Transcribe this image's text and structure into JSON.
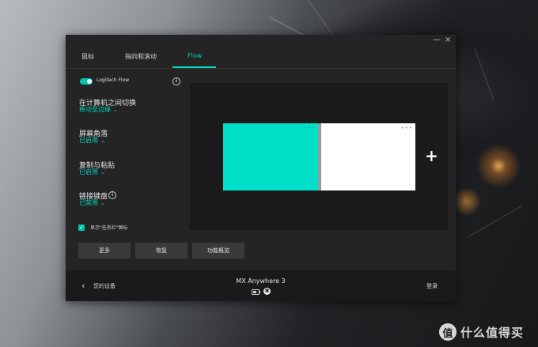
{
  "window": {
    "controls": {
      "minimize": "—",
      "close": "×"
    },
    "tabs": [
      {
        "label": "鼠标",
        "active": false
      },
      {
        "label": "指向和滚动",
        "active": false
      },
      {
        "label": "Flow",
        "active": true
      }
    ]
  },
  "flow": {
    "toggle_label": "Logitech Flow",
    "toggle_on": true,
    "info_icon": "info-icon",
    "settings": [
      {
        "title": "在计算机之间切换",
        "value": "移动至边缘"
      },
      {
        "title": "屏幕角落",
        "value": "已启用"
      },
      {
        "title": "复制与粘贴",
        "value": "已启用"
      },
      {
        "title": "链接键盘",
        "value": "已禁用"
      }
    ],
    "taskbar_checkbox_label": "显示\"任务栏\"图标",
    "taskbar_checked": true,
    "buttons": {
      "more": "更多",
      "restore": "恢复",
      "overview": "功能概览"
    },
    "preview": {
      "screen_a_color": "#00e0c8",
      "screen_b_color": "#ffffff",
      "menu_dots": "•••",
      "add": "+"
    }
  },
  "bottom": {
    "back_label": "您的设备",
    "device_name": "MX Anywhere 3",
    "login_label": "登录",
    "bluetooth_glyph": "✱"
  },
  "watermark": {
    "logo": "值",
    "text": "什么值得买"
  },
  "colors": {
    "accent": "#00d5bd",
    "window_bg": "#242424",
    "bar_bg": "#1a1a1a"
  }
}
